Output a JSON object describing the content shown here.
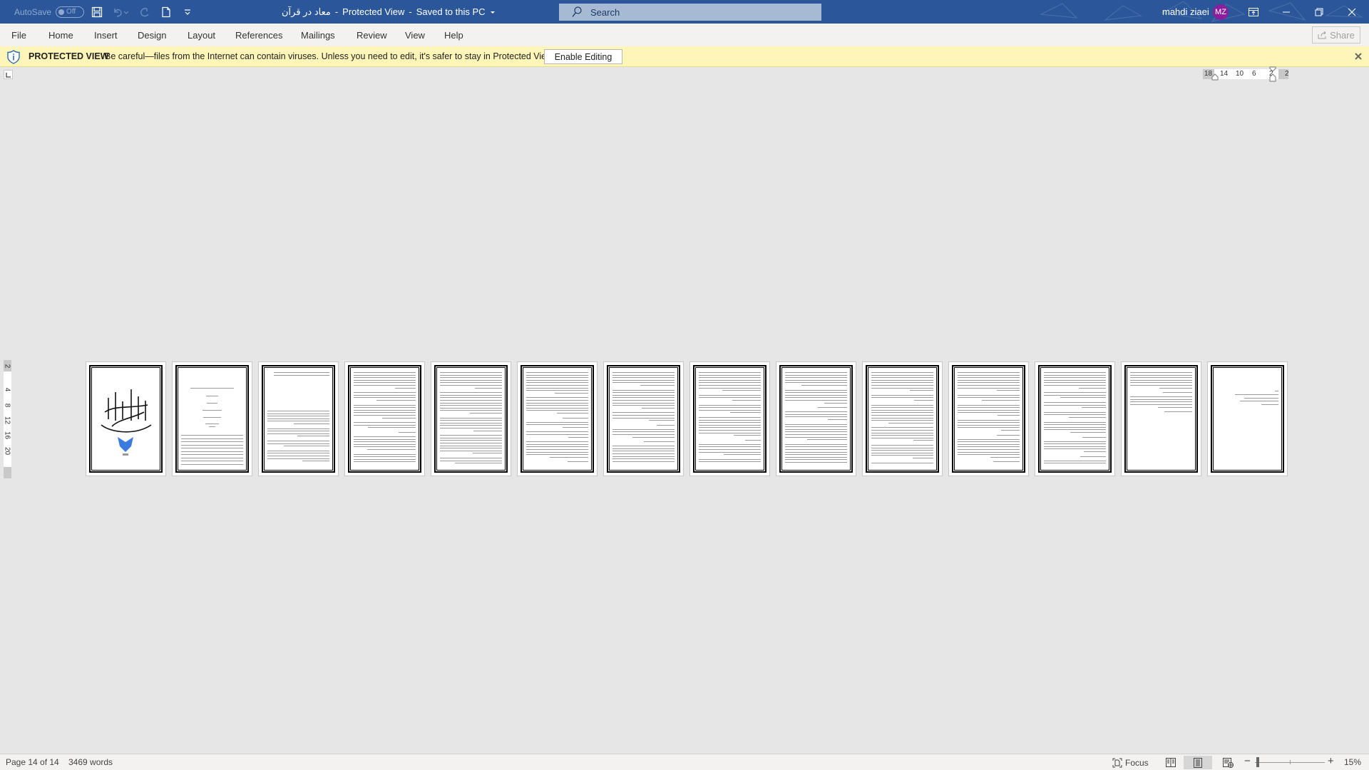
{
  "titlebar": {
    "autosave_label": "AutoSave",
    "autosave_state": "Off",
    "document_title": "معاد در قرآن",
    "separator1": "-",
    "view_mode": "Protected View",
    "separator2": "-",
    "save_status": "Saved to this PC",
    "search_placeholder": "Search",
    "user_name": "mahdi ziaei",
    "user_initials": "MZ",
    "avatar_color": "#8a1e9c",
    "accent_color": "#2b579a"
  },
  "menu": {
    "items": [
      {
        "label": "File"
      },
      {
        "label": "Home"
      },
      {
        "label": "Insert"
      },
      {
        "label": "Design"
      },
      {
        "label": "Layout"
      },
      {
        "label": "References"
      },
      {
        "label": "Mailings"
      },
      {
        "label": "Review"
      },
      {
        "label": "View"
      },
      {
        "label": "Help"
      }
    ],
    "share_label": "Share"
  },
  "protected_view": {
    "title": "PROTECTED VIEW",
    "message": "Be careful—files from the Internet can contain viruses. Unless you need to edit, it's safer to stay in Protected View.",
    "enable_button": "Enable Editing",
    "bar_color": "#fdf6b8"
  },
  "ruler": {
    "horizontal_ticks": [
      "18",
      "14",
      "10",
      "6",
      "2",
      "2"
    ],
    "vertical_ticks": [
      "2",
      "4",
      "8",
      "12",
      "16",
      "20"
    ]
  },
  "document": {
    "page_count": 14,
    "zoom_percent": 15,
    "pages": [
      {
        "number": 1,
        "type": "cover-calligraphy"
      },
      {
        "number": 2,
        "type": "title-and-toc"
      },
      {
        "number": 3,
        "type": "text"
      },
      {
        "number": 4,
        "type": "text"
      },
      {
        "number": 5,
        "type": "text"
      },
      {
        "number": 6,
        "type": "text"
      },
      {
        "number": 7,
        "type": "text"
      },
      {
        "number": 8,
        "type": "text"
      },
      {
        "number": 9,
        "type": "text"
      },
      {
        "number": 10,
        "type": "text"
      },
      {
        "number": 11,
        "type": "text"
      },
      {
        "number": 12,
        "type": "text"
      },
      {
        "number": 13,
        "type": "text-partial"
      },
      {
        "number": 14,
        "type": "references-short"
      }
    ]
  },
  "statusbar": {
    "page_info": "Page 14 of 14",
    "word_count": "3469 words",
    "focus_label": "Focus",
    "zoom_minus": "−",
    "zoom_plus": "+",
    "zoom_label": "15%"
  }
}
